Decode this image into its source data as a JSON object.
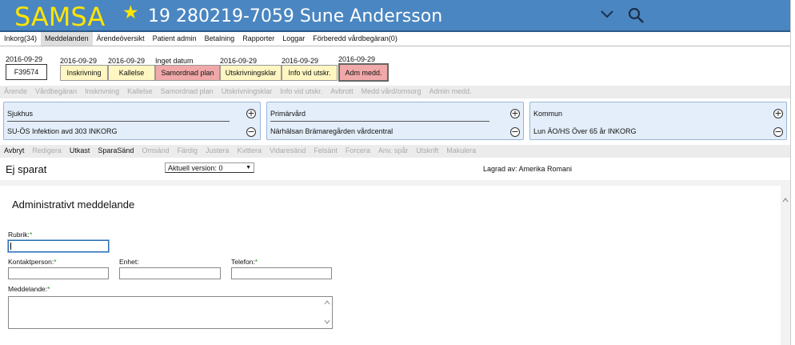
{
  "header": {
    "logo": "SAMSA",
    "patient": "19 280219-7059 Sune Andersson"
  },
  "menu": [
    {
      "label": "Inkorg(34)",
      "active": false
    },
    {
      "label": "Meddelanden",
      "active": true
    },
    {
      "label": "Ärendeöversikt",
      "active": false
    },
    {
      "label": "Patient admin",
      "active": false
    },
    {
      "label": "Betalning",
      "active": false
    },
    {
      "label": "Rapporter",
      "active": false
    },
    {
      "label": "Loggar",
      "active": false
    },
    {
      "label": "Förberedd vårdbegäran(0)",
      "active": false
    }
  ],
  "status": {
    "case_date": "2016-09-29",
    "case_id": "F39574",
    "steps": [
      {
        "date": "2016-09-29",
        "label": "Inskrivning"
      },
      {
        "date": "2016-09-29",
        "label": "Kallelse"
      },
      {
        "date": "Inget datum",
        "label": "Samordnad plan"
      },
      {
        "date": "2016-09-29",
        "label": "Utskrivningsklar"
      },
      {
        "date": "2016-09-29",
        "label": "Info vid utskr."
      },
      {
        "date": "2016-09-29",
        "label": "Adm medd."
      }
    ]
  },
  "actions1": [
    "Ärende",
    "Vårdbegäran",
    "Inskrivning",
    "Kallelse",
    "Samordnad plan",
    "Utskrivningsklar",
    "Info vid utskr.",
    "Avbrott",
    "Medd vård/omsorg",
    "Admin medd."
  ],
  "orgs": [
    {
      "title": "Sjukhus",
      "value": "SU-ÖS Infektion avd 303 INKORG"
    },
    {
      "title": "Primärvård",
      "value": "Närhälsan Brämaregården vårdcentral"
    },
    {
      "title": "Kommun",
      "value": "Lun ÄO/HS Över 65 år INKORG"
    }
  ],
  "actions2": [
    {
      "label": "Avbryt",
      "enabled": true
    },
    {
      "label": "Redigera",
      "enabled": false
    },
    {
      "label": "Utkast",
      "enabled": true
    },
    {
      "label": "SparaSänd",
      "enabled": true
    },
    {
      "label": "Omsänd",
      "enabled": false
    },
    {
      "label": "Färdig",
      "enabled": false
    },
    {
      "label": "Justera",
      "enabled": false
    },
    {
      "label": "Kvittera",
      "enabled": false
    },
    {
      "label": "Vidaresänd",
      "enabled": false
    },
    {
      "label": "Felsänt",
      "enabled": false
    },
    {
      "label": "Forcera",
      "enabled": false
    },
    {
      "label": "Anv. spår",
      "enabled": false
    },
    {
      "label": "Utskrift",
      "enabled": false
    },
    {
      "label": "Makulera",
      "enabled": false
    }
  ],
  "doc": {
    "state": "Ej sparat",
    "version": "Aktuell version: 0",
    "saved_by": "Lagrad av: Amerika Romani"
  },
  "form": {
    "title": "Administrativt meddelande",
    "rubrik_label": "Rubrik:",
    "contact_label": "Kontaktperson:",
    "unit_label": "Enhet:",
    "phone_label": "Telefon:",
    "message_label": "Meddelande:",
    "required_mark": "*"
  }
}
